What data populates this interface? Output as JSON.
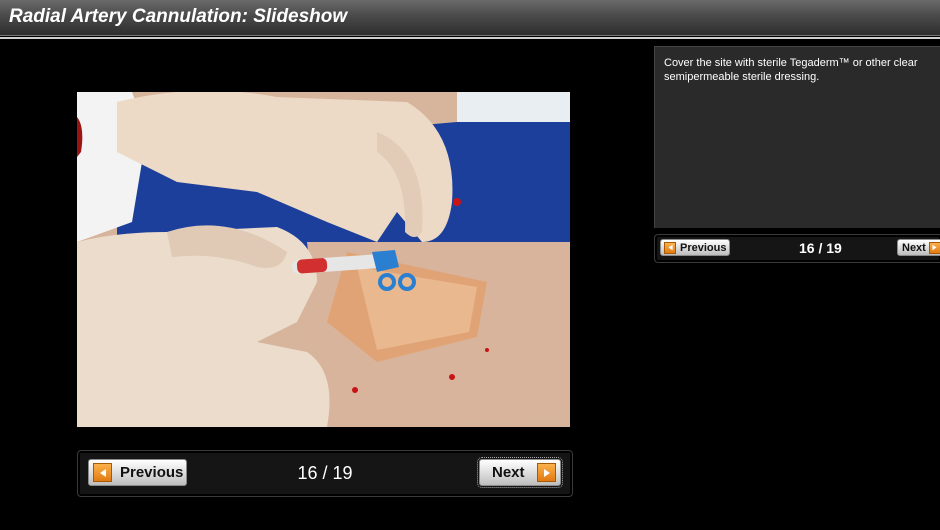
{
  "header": {
    "title": "Radial Artery Cannulation: Slideshow"
  },
  "slide": {
    "image_alt": "Clinician covering a cannulated radial artery site on a wrist with a clear sterile dressing"
  },
  "main_nav": {
    "previous_label": "Previous",
    "next_label": "Next",
    "counter": "16 / 19"
  },
  "caption": {
    "text": "Cover the site with sterile Tegaderm™ or other clear semipermeable sterile dressing."
  },
  "side_nav": {
    "previous_label": "Previous",
    "next_label": "Next",
    "counter": "16 / 19"
  },
  "colors": {
    "accent_orange": "#f29a2e",
    "panel": "#2a2a2a",
    "background": "#000000"
  }
}
